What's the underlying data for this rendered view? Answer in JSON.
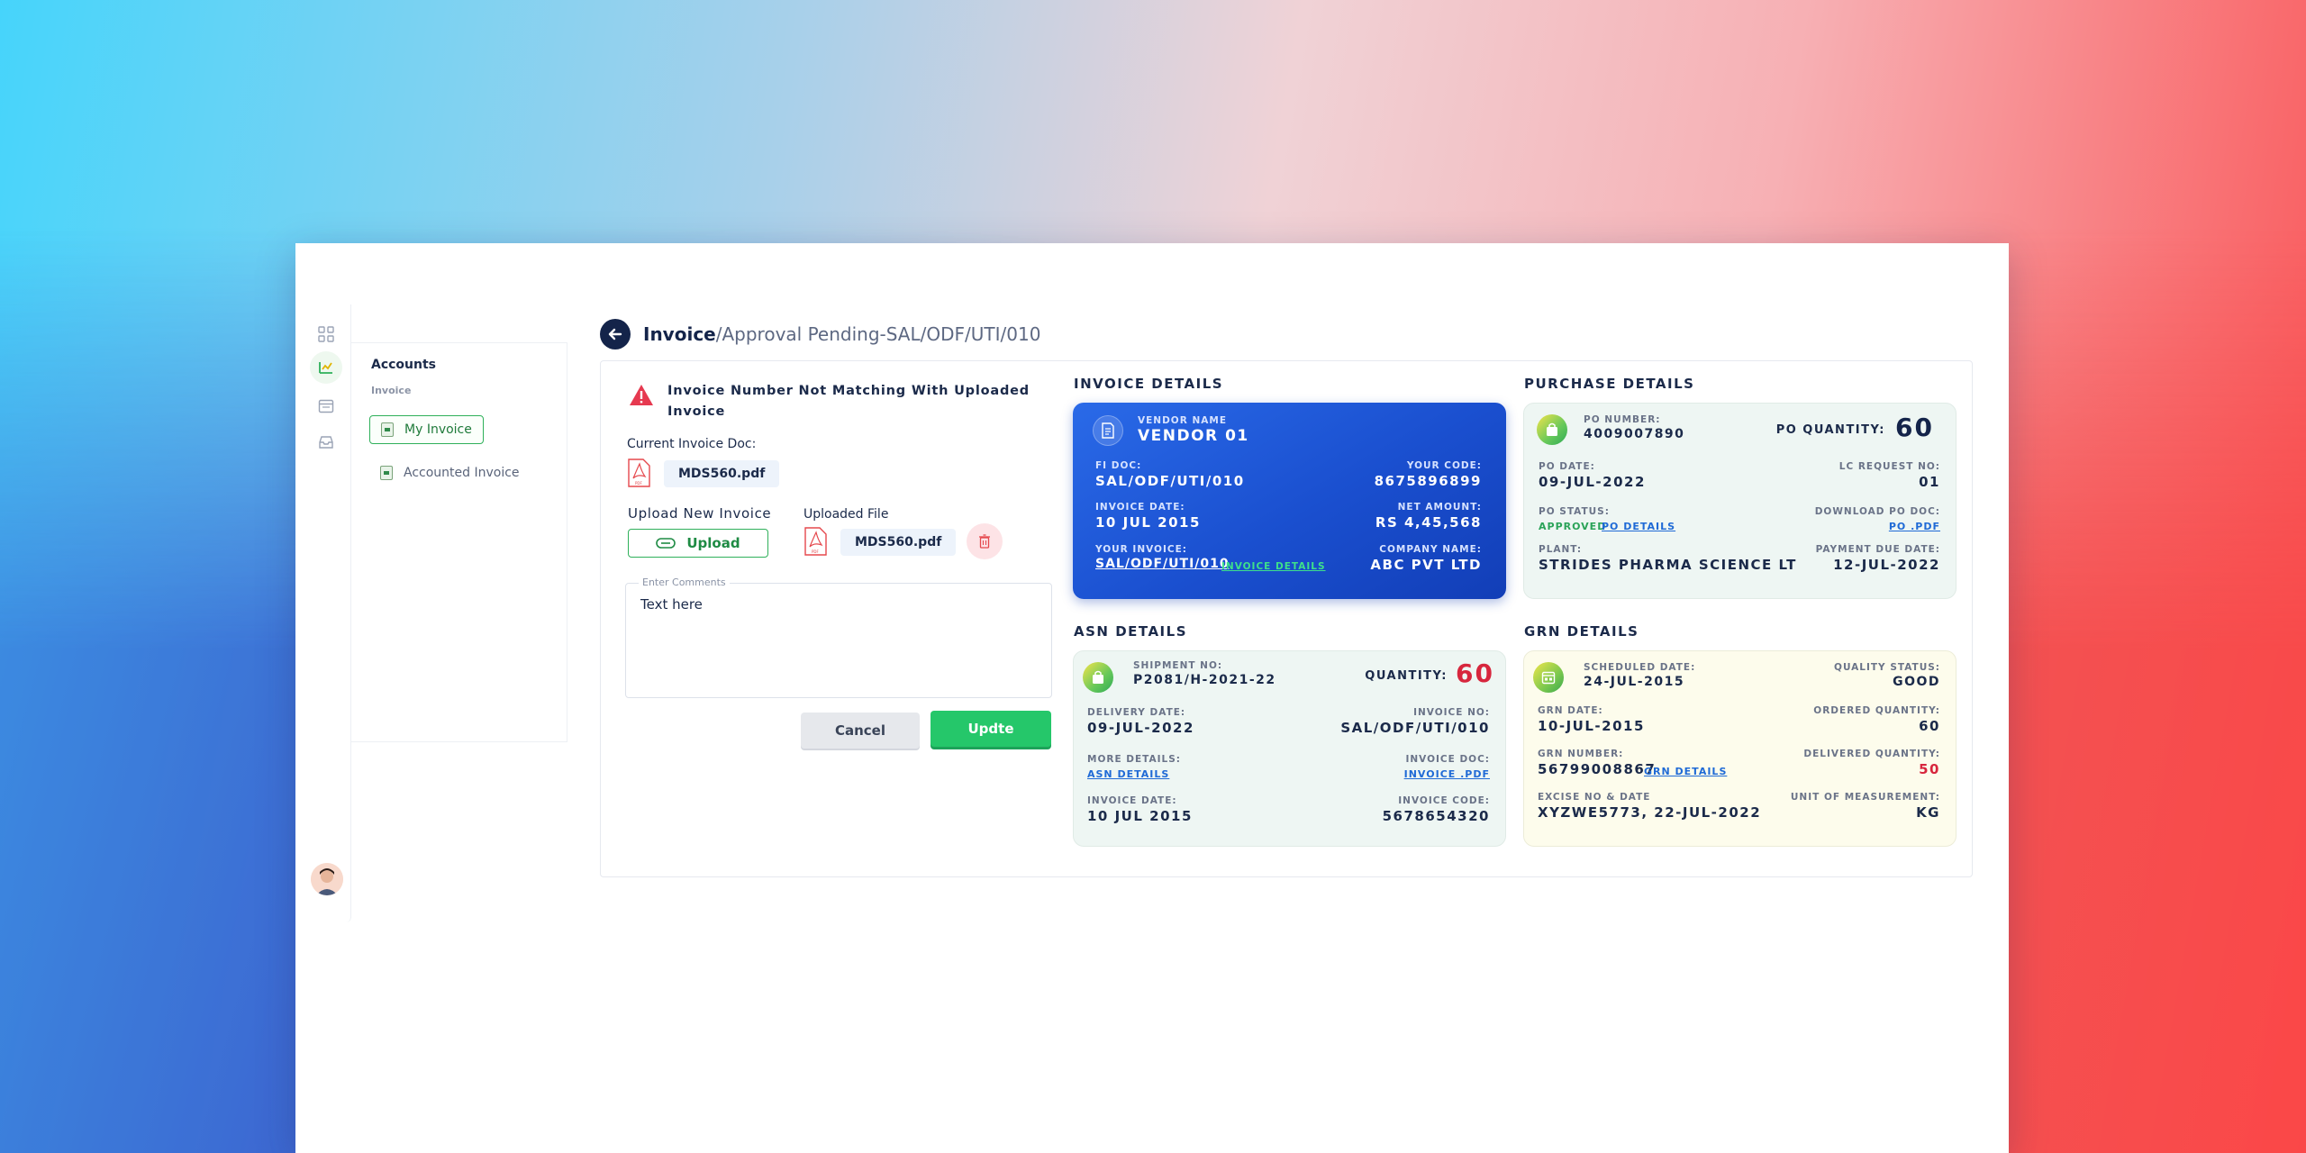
{
  "breadcrumb": {
    "strong": "Invoice",
    "light": "/Approval Pending-SAL/ODF/UTI/010"
  },
  "subnav": {
    "title": "Accounts",
    "section": "Invoice",
    "items": [
      {
        "label": "My Invoice"
      },
      {
        "label": "Accounted Invoice"
      }
    ]
  },
  "left": {
    "warning": "Invoice Number Not Matching With Uploaded Invoice",
    "current_doc_label": "Current Invoice Doc:",
    "current_doc_file": "MDS560.pdf",
    "upload_label": "Upload New Invoice",
    "upload_button": "Upload",
    "uploaded_label": "Uploaded File",
    "uploaded_file": "MDS560.pdf",
    "comments_legend": "Enter Comments",
    "comments_value": "Text here",
    "cancel": "Cancel",
    "update": "Updte"
  },
  "invoice": {
    "title": "INVOICE DETAILS",
    "vendor_label": "VENDOR NAME",
    "vendor": "VENDOR 01",
    "fi_doc_label": "FI DOC:",
    "fi_doc": "SAL/ODF/UTI/010",
    "your_code_label": "YOUR CODE:",
    "your_code": "8675896899",
    "invoice_date_label": "INVOICE DATE:",
    "invoice_date": "10 JUL 2015",
    "net_amount_label": "NET AMOUNT:",
    "net_amount": "RS 4,45,568",
    "your_invoice_label": "YOUR INVOICE:",
    "your_invoice": "SAL/ODF/UTI/010",
    "details_link": "INVOICE DETAILS",
    "company_label": "COMPANY NAME:",
    "company": "ABC PVT LTD"
  },
  "purchase": {
    "title": "PURCHASE DETAILS",
    "po_number_label": "PO NUMBER:",
    "po_number": "4009007890",
    "po_qty_label": "PO QUANTITY:",
    "po_qty": "60",
    "po_date_label": "PO DATE:",
    "po_date": "09-JUL-2022",
    "lc_label": "LC REQUEST NO:",
    "lc": "01",
    "po_status_label": "PO STATUS:",
    "po_status": "APPROVED",
    "po_details_link": "PO DETAILS",
    "download_label": "DOWNLOAD PO DOC:",
    "download_link": "PO .PDF",
    "plant_label": "PLANT:",
    "plant": "STRIDES PHARMA SCIENCE LT",
    "due_label": "PAYMENT DUE DATE:",
    "due": "12-JUL-2022"
  },
  "asn": {
    "title": "ASN DETAILS",
    "shipment_label": "SHIPMENT NO:",
    "shipment": "P2081/H-2021-22",
    "qty_label": "QUANTITY:",
    "qty": "60",
    "delivery_label": "DELIVERY DATE:",
    "delivery": "09-JUL-2022",
    "inv_no_label": "INVOICE NO:",
    "inv_no": "SAL/ODF/UTI/010",
    "more_label": "MORE DETAILS:",
    "more_link": "ASN DETAILS",
    "inv_doc_label": "INVOICE DOC:",
    "inv_doc_link": "INVOICE .PDF",
    "inv_date_label": "INVOICE DATE:",
    "inv_date": "10 JUL 2015",
    "inv_code_label": "INVOICE CODE:",
    "inv_code": "5678654320"
  },
  "grn": {
    "title": "GRN DETAILS",
    "scheduled_label": "SCHEDULED DATE:",
    "scheduled": "24-JUL-2015",
    "quality_label": "QUALITY STATUS:",
    "quality": "GOOD",
    "grn_date_label": "GRN DATE:",
    "grn_date": "10-JUL-2015",
    "ordered_label": "ORDERED QUANTITY:",
    "ordered": "60",
    "grn_number_label": "GRN NUMBER:",
    "grn_number": "56799008867",
    "grn_details_link": "GRN DETAILS",
    "delivered_label": "DELIVERED QUANTITY:",
    "delivered": "50",
    "excise_label": "EXCISE NO & DATE",
    "excise": "XYZWE5773, 22-JUL-2022",
    "uom_label": "UNIT OF MEASUREMENT:",
    "uom": "KG"
  },
  "colors": {
    "accent_green": "#25c76a",
    "navy": "#14244a",
    "alert_red": "#d7263d",
    "blue_card": "#1a4fcf"
  }
}
